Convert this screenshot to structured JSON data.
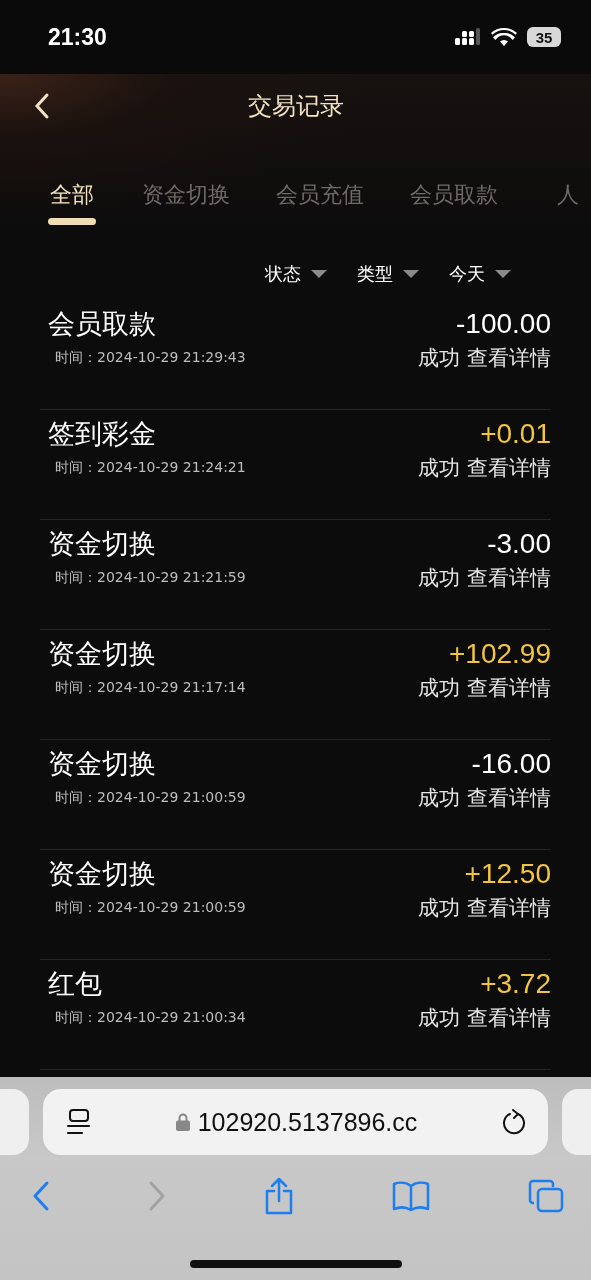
{
  "status_bar": {
    "time": "21:30",
    "battery": "35"
  },
  "header": {
    "title": "交易记录"
  },
  "tabs": [
    {
      "label": "全部",
      "selected": true
    },
    {
      "label": "资金切换",
      "selected": false
    },
    {
      "label": "会员充值",
      "selected": false
    },
    {
      "label": "会员取款",
      "selected": false
    },
    {
      "label": "人",
      "selected": false
    }
  ],
  "filters": [
    "状态",
    "类型",
    "今天"
  ],
  "transactions": [
    {
      "title": "会员取款",
      "time": "时间：2024-10-29 21:29:43",
      "amount": "-100.00",
      "kind": "debit",
      "status": "成功",
      "action": "查看详情"
    },
    {
      "title": "签到彩金",
      "time": "时间：2024-10-29 21:24:21",
      "amount": "+0.01",
      "kind": "credit",
      "status": "成功",
      "action": "查看详情"
    },
    {
      "title": "资金切换",
      "time": "时间：2024-10-29 21:21:59",
      "amount": "-3.00",
      "kind": "debit",
      "status": "成功",
      "action": "查看详情"
    },
    {
      "title": "资金切换",
      "time": "时间：2024-10-29 21:17:14",
      "amount": "+102.99",
      "kind": "credit",
      "status": "成功",
      "action": "查看详情"
    },
    {
      "title": "资金切换",
      "time": "时间：2024-10-29 21:00:59",
      "amount": "-16.00",
      "kind": "debit",
      "status": "成功",
      "action": "查看详情"
    },
    {
      "title": "资金切换",
      "time": "时间：2024-10-29 21:00:59",
      "amount": "+12.50",
      "kind": "credit",
      "status": "成功",
      "action": "查看详情"
    },
    {
      "title": "红包",
      "time": "时间：2024-10-29 21:00:34",
      "amount": "+3.72",
      "kind": "credit",
      "status": "成功",
      "action": "查看详情"
    }
  ],
  "browser": {
    "url": "102920.5137896.cc",
    "forward_disabled": true
  }
}
